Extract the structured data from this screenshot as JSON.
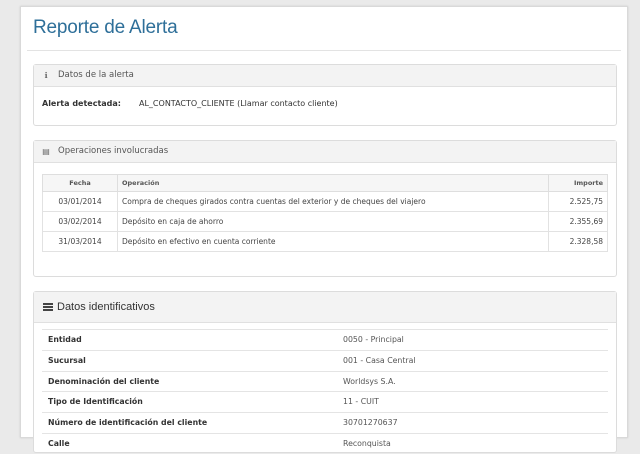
{
  "page": {
    "title": "Reporte de Alerta"
  },
  "alert_panel": {
    "heading": "Datos de la alerta",
    "icon": "info-icon",
    "label": "Alerta detectada:",
    "value": "AL_CONTACTO_CLIENTE (Llamar contacto cliente)"
  },
  "operations_panel": {
    "heading": "Operaciones involucradas",
    "icon": "table-icon",
    "columns": [
      "Fecha",
      "Operación",
      "Importe"
    ],
    "rows": [
      {
        "fecha": "03/01/2014",
        "operacion": "Compra de cheques girados contra cuentas del exterior y de cheques del viajero",
        "importe": "2.525,75"
      },
      {
        "fecha": "03/02/2014",
        "operacion": "Depósito en caja de ahorro",
        "importe": "2.355,69"
      },
      {
        "fecha": "31/03/2014",
        "operacion": "Depósito en efectivo en cuenta corriente",
        "importe": "2.328,58"
      }
    ]
  },
  "identity_panel": {
    "heading": "Datos identificativos",
    "icon": "list-icon",
    "rows": [
      {
        "label": "Entidad",
        "value": "0050 - Principal"
      },
      {
        "label": "Sucursal",
        "value": "001 - Casa Central"
      },
      {
        "label": "Denominación del cliente",
        "value": "Worldsys S.A."
      },
      {
        "label": "Tipo de Identificación",
        "value": "11 - CUIT"
      },
      {
        "label": "Número de identificación del cliente",
        "value": "30701270637"
      },
      {
        "label": "Calle",
        "value": "Reconquista"
      }
    ]
  },
  "colors": {
    "title": "#2e6f99",
    "page_bg": "#eaeaea",
    "panel_head_bg": "#f3f3f3"
  }
}
